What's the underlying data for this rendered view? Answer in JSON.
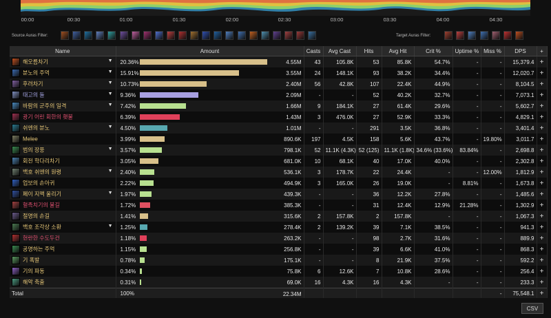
{
  "timeline": {
    "ticks": [
      "00:00",
      "00:30",
      "01:00",
      "01:30",
      "02:00",
      "02:30",
      "03:00",
      "03:30",
      "04:00",
      "04:30"
    ]
  },
  "filters": {
    "source_label": "Source Auras Filter:",
    "target_label": "Target Auras Filter:",
    "source_icons": [
      "#a05020",
      "#4060a0",
      "#2070a0",
      "#6080c0",
      "#30a0a0",
      "#7050a0",
      "#c060a0",
      "#a03070",
      "#5070d0",
      "#c04040",
      "#b03030",
      "#a07030",
      "#3050b0",
      "#2060a0",
      "#5080c0",
      "#4070b0",
      "#c06020",
      "#5090b0",
      "#604090",
      "#a04040",
      "#9a3a3a",
      "#3a70a0"
    ],
    "target_icons": [
      "#a04030",
      "#c04040",
      "#5080c0",
      "#4070b0",
      "#a06070",
      "#c03030",
      "#c05020"
    ]
  },
  "table": {
    "headers": {
      "name": "Name",
      "amount": "Amount",
      "casts": "Casts",
      "avg_cast": "Avg Cast",
      "hits": "Hits",
      "avg_hit": "Avg Hit",
      "crit": "Crit %",
      "uptime": "Uptime %",
      "miss": "Miss %",
      "dps": "DPS",
      "plus": "+"
    },
    "rows": [
      {
        "name": "해오름차기",
        "color": "#e8c878",
        "icon": "#c05020",
        "caret": true,
        "pct": "20.36%",
        "frac": 1.0,
        "bar": "#d8c08a",
        "amount": "4.55M",
        "casts": "43",
        "avg_cast": "105.8K",
        "hits": "53",
        "avg_hit": "85.8K",
        "crit": "54.7%",
        "uptime": "-",
        "miss": "-",
        "dps": "15,379.4"
      },
      {
        "name": "분노의 주먹",
        "color": "#e8c878",
        "icon": "#3a6ab0",
        "caret": true,
        "pct": "15.91%",
        "frac": 0.781,
        "bar": "#d8c08a",
        "amount": "3.55M",
        "casts": "24",
        "avg_cast": "148.1K",
        "hits": "93",
        "avg_hit": "38.2K",
        "crit": "34.4%",
        "uptime": "-",
        "miss": "-",
        "dps": "12,020.7"
      },
      {
        "name": "후려차기",
        "color": "#e8c878",
        "icon": "#8060a0",
        "caret": true,
        "pct": "10.73%",
        "frac": 0.527,
        "bar": "#d8c08a",
        "amount": "2.40M",
        "casts": "56",
        "avg_cast": "42.8K",
        "hits": "107",
        "avg_hit": "22.4K",
        "crit": "44.9%",
        "uptime": "-",
        "miss": "-",
        "dps": "8,104.5"
      },
      {
        "name": "태고의 돌",
        "color": "#a8a8e8",
        "icon": "#8090c0",
        "caret": true,
        "pct": "9.36%",
        "frac": 0.46,
        "bar": "#a8a0e0",
        "amount": "2.09M",
        "casts": "-",
        "avg_cast": "-",
        "hits": "52",
        "avg_hit": "40.2K",
        "crit": "32.7%",
        "uptime": "-",
        "miss": "-",
        "dps": "7,073.1"
      },
      {
        "name": "바람의 군주의 일격",
        "color": "#e8c878",
        "icon": "#4a8ac0",
        "caret": true,
        "pct": "7.42%",
        "frac": 0.365,
        "bar": "#b8e090",
        "amount": "1.66M",
        "casts": "9",
        "avg_cast": "184.1K",
        "hits": "27",
        "avg_hit": "61.4K",
        "crit": "29.6%",
        "uptime": "-",
        "miss": "-",
        "dps": "5,602.7"
      },
      {
        "name": "광기 어린 회한의 횃불",
        "color": "#e05070",
        "icon": "#a03050",
        "caret": false,
        "pct": "6.39%",
        "frac": 0.314,
        "bar": "#e0405a",
        "amount": "1.43M",
        "casts": "3",
        "avg_cast": "476.0K",
        "hits": "27",
        "avg_hit": "52.9K",
        "crit": "33.3%",
        "uptime": "-",
        "miss": "-",
        "dps": "4,829.1"
      },
      {
        "name": "쉬엔의 분노",
        "color": "#e8c878",
        "icon": "#2a7a90",
        "caret": true,
        "pct": "4.50%",
        "frac": 0.221,
        "bar": "#58a8b0",
        "amount": "1.01M",
        "casts": "-",
        "avg_cast": "-",
        "hits": "291",
        "avg_hit": "3.5K",
        "crit": "36.8%",
        "uptime": "-",
        "miss": "-",
        "dps": "3,401.4"
      },
      {
        "name": "Melee",
        "color": "#e8c878",
        "icon": "#7a7a60",
        "caret": false,
        "pct": "3.99%",
        "frac": 0.196,
        "bar": "#d8c08a",
        "amount": "890.6K",
        "casts": "197",
        "avg_cast": "4.5K",
        "hits": "158",
        "avg_hit": "5.6K",
        "crit": "43.7%",
        "uptime": "-",
        "miss": "19.80%",
        "dps": "3,011.7"
      },
      {
        "name": "범의 장풍",
        "color": "#e8c878",
        "icon": "#3a8a50",
        "caret": true,
        "pct": "3.57%",
        "frac": 0.175,
        "bar": "#b8e090",
        "amount": "798.1K",
        "casts": "52",
        "avg_cast": "11.1K (4.3K)",
        "hits": "52 (125)",
        "avg_hit": "11.1K (1.8K)",
        "crit": "34.6% (33.6%)",
        "uptime": "83.84%",
        "miss": "-",
        "dps": "2,698.8"
      },
      {
        "name": "회전 학다리차기",
        "color": "#e8c878",
        "icon": "#4a80b0",
        "caret": false,
        "pct": "3.05%",
        "frac": 0.15,
        "bar": "#d8c08a",
        "amount": "681.0K",
        "casts": "10",
        "avg_cast": "68.1K",
        "hits": "40",
        "avg_hit": "17.0K",
        "crit": "40.0%",
        "uptime": "-",
        "miss": "-",
        "dps": "2,302.8"
      },
      {
        "name": "백호 쉬엔의 원령",
        "color": "#e8c878",
        "icon": "#708070",
        "caret": true,
        "pct": "2.40%",
        "frac": 0.118,
        "bar": "#b8e090",
        "amount": "536.1K",
        "casts": "3",
        "avg_cast": "178.7K",
        "hits": "22",
        "avg_hit": "24.4K",
        "crit": "-",
        "uptime": "-",
        "miss": "12.00%",
        "dps": "1,812.9"
      },
      {
        "name": "업보의 손아귀",
        "color": "#e8c878",
        "icon": "#3060c0",
        "caret": false,
        "pct": "2.22%",
        "frac": 0.109,
        "bar": "#b8e090",
        "amount": "494.9K",
        "casts": "3",
        "avg_cast": "165.0K",
        "hits": "26",
        "avg_hit": "19.0K",
        "crit": "-",
        "uptime": "8.81%",
        "miss": "-",
        "dps": "1,673.8"
      },
      {
        "name": "폐이 지맥 울리기",
        "color": "#e8c878",
        "icon": "#3050a0",
        "caret": true,
        "pct": "1.97%",
        "frac": 0.097,
        "bar": "#b8e090",
        "amount": "439.3K",
        "casts": "-",
        "avg_cast": "-",
        "hits": "36",
        "avg_hit": "12.2K",
        "crit": "27.8%",
        "uptime": "-",
        "miss": "-",
        "dps": "1,485.6"
      },
      {
        "name": "혈족치기의 불길",
        "color": "#e05070",
        "icon": "#a04040",
        "caret": false,
        "pct": "1.72%",
        "frac": 0.084,
        "bar": "#e05060",
        "amount": "385.3K",
        "casts": "-",
        "avg_cast": "-",
        "hits": "31",
        "avg_hit": "12.4K",
        "crit": "12.9%",
        "uptime": "21.28%",
        "miss": "-",
        "dps": "1,302.9"
      },
      {
        "name": "절명의 손길",
        "color": "#e8c878",
        "icon": "#6a5a8a",
        "caret": false,
        "pct": "1.41%",
        "frac": 0.069,
        "bar": "#d8c08a",
        "amount": "315.6K",
        "casts": "2",
        "avg_cast": "157.8K",
        "hits": "2",
        "avg_hit": "157.8K",
        "crit": "-",
        "uptime": "-",
        "miss": "-",
        "dps": "1,067.3"
      },
      {
        "name": "백호 조각상 소환",
        "color": "#e8c878",
        "icon": "#4a7a50",
        "caret": true,
        "pct": "1.25%",
        "frac": 0.061,
        "bar": "#58a8b0",
        "amount": "278.4K",
        "casts": "2",
        "avg_cast": "139.2K",
        "hits": "39",
        "avg_hit": "7.1K",
        "crit": "38.5%",
        "uptime": "-",
        "miss": "-",
        "dps": "941.3"
      },
      {
        "name": "현란한 수도두건",
        "color": "#e05070",
        "icon": "#b03030",
        "caret": false,
        "pct": "1.18%",
        "frac": 0.058,
        "bar": "#e0405a",
        "amount": "263.2K",
        "casts": "-",
        "avg_cast": "-",
        "hits": "98",
        "avg_hit": "2.7K",
        "crit": "31.6%",
        "uptime": "-",
        "miss": "-",
        "dps": "889.9"
      },
      {
        "name": "공명하는 주먹",
        "color": "#e8c878",
        "icon": "#3a8a50",
        "caret": false,
        "pct": "1.15%",
        "frac": 0.056,
        "bar": "#b8e090",
        "amount": "256.8K",
        "casts": "-",
        "avg_cast": "-",
        "hits": "39",
        "avg_hit": "6.6K",
        "crit": "41.0%",
        "uptime": "-",
        "miss": "-",
        "dps": "868.3"
      },
      {
        "name": "기 폭발",
        "color": "#e8c878",
        "icon": "#5a9a60",
        "caret": false,
        "pct": "0.78%",
        "frac": 0.038,
        "bar": "#b8e090",
        "amount": "175.1K",
        "casts": "-",
        "avg_cast": "-",
        "hits": "8",
        "avg_hit": "21.9K",
        "crit": "37.5%",
        "uptime": "-",
        "miss": "-",
        "dps": "592.2"
      },
      {
        "name": "기의 파동",
        "color": "#e8c878",
        "icon": "#8a60c0",
        "caret": false,
        "pct": "0.34%",
        "frac": 0.017,
        "bar": "#b8e090",
        "amount": "75.8K",
        "casts": "6",
        "avg_cast": "12.6K",
        "hits": "7",
        "avg_hit": "10.8K",
        "crit": "28.6%",
        "uptime": "-",
        "miss": "-",
        "dps": "256.4"
      },
      {
        "name": "해악 축출",
        "color": "#e8c878",
        "icon": "#4a9a80",
        "caret": false,
        "pct": "0.31%",
        "frac": 0.015,
        "bar": "#b8e090",
        "amount": "69.0K",
        "casts": "16",
        "avg_cast": "4.3K",
        "hits": "16",
        "avg_hit": "4.3K",
        "crit": "-",
        "uptime": "-",
        "miss": "-",
        "dps": "233.3"
      }
    ],
    "total": {
      "label": "Total",
      "pct": "100%",
      "amount": "22.34M",
      "casts": "",
      "avg_cast": "",
      "hits": "",
      "avg_hit": "",
      "crit": "",
      "uptime": "",
      "miss": "-",
      "dps": "75,548.1"
    }
  },
  "csv_label": "CSV"
}
